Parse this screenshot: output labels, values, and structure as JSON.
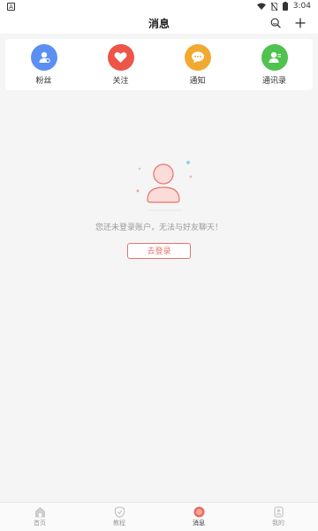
{
  "status_bar": {
    "time": "3:04"
  },
  "header": {
    "title": "消息"
  },
  "shortcuts": [
    {
      "label": "粉丝",
      "icon": "fans-icon",
      "color": "#5b8ff2"
    },
    {
      "label": "关注",
      "icon": "heart-icon",
      "color": "#ec5547"
    },
    {
      "label": "通知",
      "icon": "chat-bubble-icon",
      "color": "#f1a92f"
    },
    {
      "label": "通讯录",
      "icon": "contacts-icon",
      "color": "#4fc24f"
    }
  ],
  "empty_state": {
    "message": "您还未登录账户，无法与好友聊天！",
    "login_label": "去登录",
    "accent_color": "#e8736a"
  },
  "tabbar": {
    "items": [
      {
        "label": "首页",
        "icon": "home-icon"
      },
      {
        "label": "教程",
        "icon": "shield-icon"
      },
      {
        "label": "消息",
        "icon": "message-icon",
        "active": true
      },
      {
        "label": "我的",
        "icon": "profile-icon"
      }
    ]
  }
}
